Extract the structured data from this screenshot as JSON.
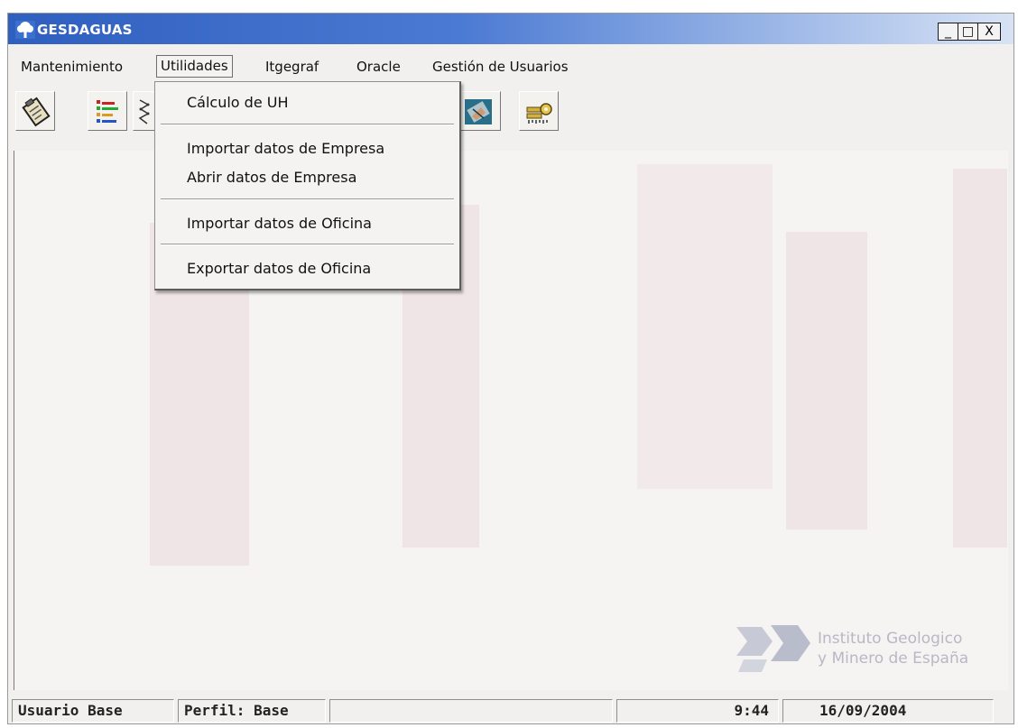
{
  "window": {
    "title": "GESDAGUAS",
    "controls": {
      "minimize": "_",
      "maximize": "□",
      "close": "X"
    }
  },
  "menubar": {
    "items": [
      {
        "label": "Mantenimiento"
      },
      {
        "label": "Utilidades",
        "open": true
      },
      {
        "label": "Itgegraf"
      },
      {
        "label": "Oracle"
      },
      {
        "label": "Gestión de Usuarios"
      }
    ]
  },
  "utilidades_menu": {
    "items": [
      {
        "label": "Cálculo de UH"
      },
      {
        "label": "Importar datos de Empresa"
      },
      {
        "label": "Abrir datos de Empresa"
      },
      {
        "label": "Importar datos de Oficina"
      },
      {
        "label": "Exportar datos de Oficina"
      }
    ]
  },
  "toolbar": {
    "buttons": [
      {
        "icon": "clipboard-icon"
      },
      {
        "icon": "bar-chart-icon"
      },
      {
        "icon": "diagram-icon"
      },
      {
        "icon": "map-icon"
      },
      {
        "icon": "keys-icon"
      }
    ]
  },
  "watermark": {
    "line1": "Instituto Geologico",
    "line2": "y Minero de España"
  },
  "statusbar": {
    "user": "Usuario Base",
    "profile": "Perfil: Base",
    "time": "9:44",
    "date": "16/09/2004"
  },
  "colors": {
    "titlebar_start": "#2f5fbf",
    "titlebar_end": "#d8e3f5",
    "background": "#f1f0ee"
  }
}
